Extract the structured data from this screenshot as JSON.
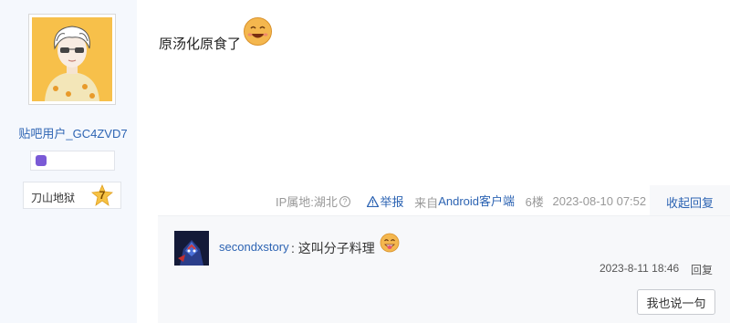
{
  "author": {
    "username": "贴吧用户_GC4ZVD7",
    "level_name": "刀山地狱",
    "level_number": "7"
  },
  "post": {
    "text": "原汤化原食了",
    "emoji_icon": "grinning-face-emoji",
    "ip_location": "IP属地:湖北",
    "help_icon": "question-circle-icon",
    "report_label": "举报",
    "from_prefix": "来自",
    "from_client": "Android客户端",
    "floor": "6楼",
    "datetime": "2023-08-10 07:52",
    "collapse_label": "收起回复"
  },
  "reply": {
    "username": "secondxstory",
    "text": ": 这叫分子料理",
    "emoji_icon": "tongue-face-emoji",
    "date": "2023-8-11 18:46",
    "reply_label": "回复",
    "say_button": "我也说一句"
  }
}
